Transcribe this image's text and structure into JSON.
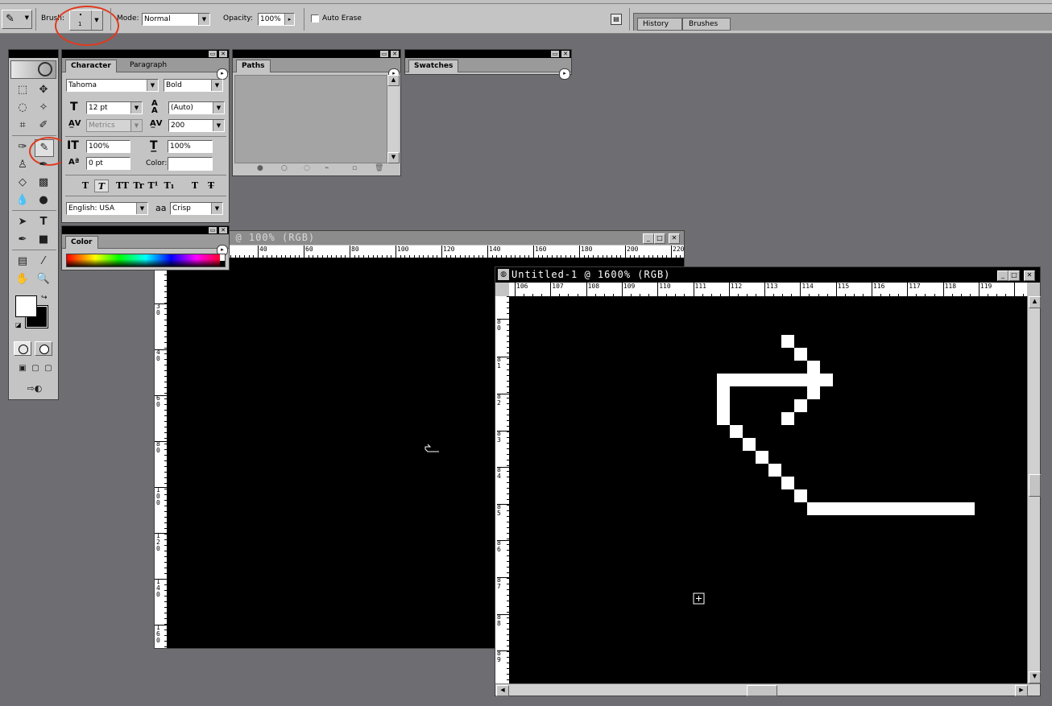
{
  "options_bar": {
    "brush_label": "Brush:",
    "brush_size": "1",
    "mode_label": "Mode:",
    "mode_value": "Normal",
    "opacity_label": "Opacity:",
    "opacity_value": "100%",
    "auto_erase_label": "Auto Erase",
    "auto_erase_checked": false,
    "well_tabs": [
      "History",
      "Brushes"
    ]
  },
  "character_palette": {
    "tabs": [
      "Character",
      "Paragraph"
    ],
    "font_family": "Tahoma",
    "font_style": "Bold",
    "font_size": "12 pt",
    "leading": "(Auto)",
    "kerning": "Metrics",
    "tracking": "200",
    "vertical_scale": "100%",
    "horizontal_scale": "100%",
    "baseline_shift": "0 pt",
    "color_label": "Color:",
    "style_buttons": [
      "T",
      "T",
      "TT",
      "Tr",
      "T¹",
      "T₁",
      "T",
      "T̶"
    ],
    "language": "English: USA",
    "antialias_label": "aa",
    "antialias": "Crisp"
  },
  "paths_palette": {
    "tabs": [
      "Paths"
    ]
  },
  "swatches_palette": {
    "tabs": [
      "Swatches"
    ]
  },
  "color_palette": {
    "tabs": [
      "Color"
    ]
  },
  "doc_back": {
    "title": "1 @ 100% (RGB)",
    "ruler_x": [
      "40",
      "60",
      "80",
      "100",
      "120",
      "140",
      "160",
      "180",
      "200",
      "220"
    ],
    "ruler_y": [
      "3 0",
      "4 0",
      "6 0",
      "8 0",
      "1 0 0",
      "1 2 0",
      "1 4 0",
      "1 6 0"
    ]
  },
  "doc_front": {
    "title": "Untitled-1 @ 1600% (RGB)",
    "ruler_x": [
      "106",
      "107",
      "108",
      "109",
      "110",
      "111",
      "112",
      "113",
      "114",
      "115",
      "116",
      "117",
      "118",
      "119"
    ],
    "ruler_y": [
      "8 0",
      "8 1",
      "8 2",
      "8 3",
      "8 4",
      "8 5",
      "8 6",
      "8 7",
      "8 8",
      "8 9"
    ]
  },
  "colors": {
    "annotation": "#e03a1e",
    "desktop": "#6e6e72",
    "chrome": "#c4c4c4",
    "canvas": "#000000",
    "pixels": "#ffffff"
  },
  "icons": {
    "tool_preset": "pencil-icon",
    "palette_menu": "triangle-right-icon"
  }
}
